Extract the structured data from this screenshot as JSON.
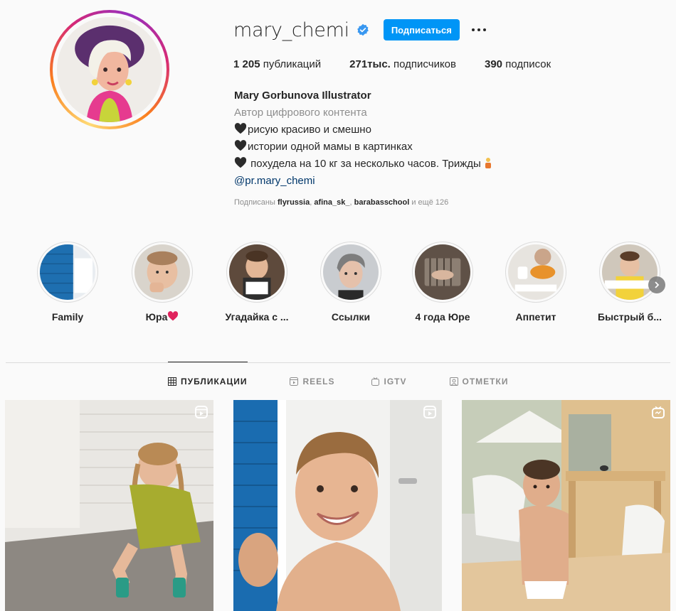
{
  "profile": {
    "username": "mary_chemi",
    "follow_label": "Подписаться",
    "stats": {
      "posts_count": "1 205",
      "posts_label": "публикаций",
      "followers_count": "271тыс.",
      "followers_label": "подписчиков",
      "following_count": "390",
      "following_label": "подписок"
    },
    "bio": {
      "name": "Mary Gorbunova Illustrator",
      "category": "Автор цифрового контента",
      "line1": "рисую красиво и смешно",
      "line2": "истории одной мамы в картинках",
      "line3": " похудела на 10 кг за несколько часов. Трижды",
      "link": "@pr.mary_chemi"
    },
    "followed_by": {
      "prefix": "Подписаны ",
      "user1": "flyrussia",
      "sep1": ", ",
      "user2": "afina_sk_",
      "sep2": ", ",
      "user3": "barabasschool",
      "suffix": " и ещё 126"
    }
  },
  "highlights": [
    {
      "label": "Family"
    },
    {
      "label": "Юра"
    },
    {
      "label": "Угадайка с ..."
    },
    {
      "label": "Ссылки"
    },
    {
      "label": "4 года Юре"
    },
    {
      "label": "Аппетит"
    },
    {
      "label": "Быстрый б..."
    }
  ],
  "tabs": [
    {
      "label": "ПУБЛИКАЦИИ",
      "icon": "grid-icon",
      "active": true
    },
    {
      "label": "REELS",
      "icon": "reels-icon",
      "active": false
    },
    {
      "label": "IGTV",
      "icon": "igtv-icon",
      "active": false
    },
    {
      "label": "ОТМЕТКИ",
      "icon": "tagged-icon",
      "active": false
    }
  ],
  "posts": [
    {
      "badge": "reels-icon"
    },
    {
      "badge": "reels-icon"
    },
    {
      "badge": "igtv-icon"
    }
  ],
  "colors": {
    "accent": "#0095f6",
    "verified": "#3897f0",
    "link": "#00376b",
    "muted": "#8e8e8e"
  }
}
